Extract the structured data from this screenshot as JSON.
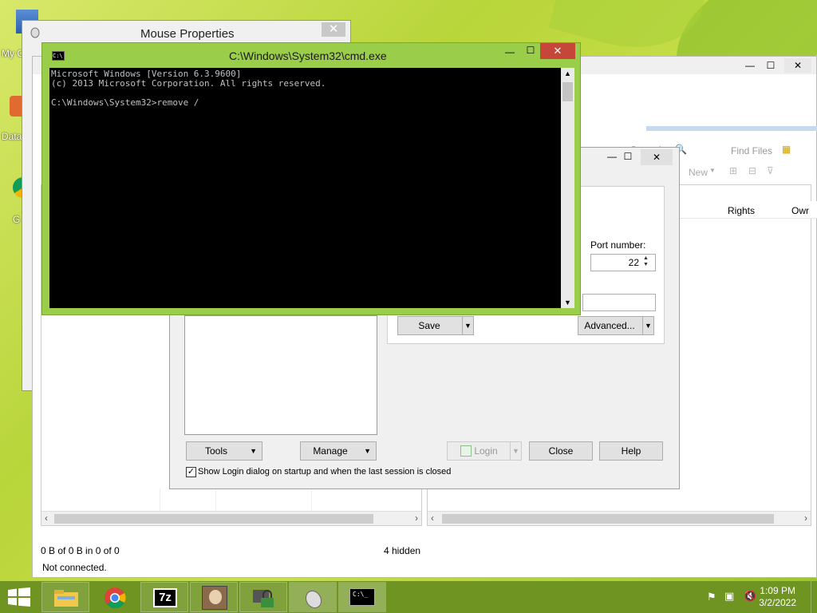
{
  "desktop": {
    "icons": [
      {
        "label": "My C"
      },
      {
        "label": "Data"
      },
      {
        "label": "G"
      }
    ]
  },
  "mouse_window": {
    "title": "Mouse Properties",
    "close_symbol": "✕"
  },
  "winscp": {
    "minimize_symbol": "—",
    "maximize_symbol": "☐",
    "close_symbol": "✕",
    "toolbar": {
      "find_files": "Find Files",
      "new_label": "New"
    },
    "remote_columns": [
      "Rights",
      "Owr"
    ],
    "status_left": "0 B of 0 B in 0 of 0",
    "hidden_count": "4 hidden",
    "connection_status": "Not connected."
  },
  "login_dialog": {
    "port_label": "Port number:",
    "port_value": "22",
    "save_label": "Save",
    "advanced_label": "Advanced...",
    "tools_label": "Tools",
    "manage_label": "Manage",
    "login_label": "Login",
    "close_label": "Close",
    "help_label": "Help",
    "startup_checkbox_label": "Show Login dialog on startup and when the last session is closed",
    "startup_checked": true
  },
  "cmd": {
    "title": "C:\\Windows\\System32\\cmd.exe",
    "icon_text": "C:\\",
    "lines": [
      "Microsoft Windows [Version 6.3.9600]",
      "(c) 2013 Microsoft Corporation. All rights reserved.",
      "",
      "C:\\Windows\\System32>remove /"
    ],
    "minimize_symbol": "—",
    "maximize_symbol": "☐",
    "close_symbol": "✕"
  },
  "taskbar": {
    "time": "1:09 PM",
    "date": "3/2/2022",
    "items": [
      "file-explorer",
      "chrome",
      "7-zip",
      "winscp-user",
      "winscp-lock",
      "mouse",
      "cmd"
    ],
    "sevenzip_text": "7z"
  },
  "colors": {
    "accent_green": "#9acd4a",
    "taskbar": "#6f9421",
    "cmd_close": "#c7463a"
  }
}
